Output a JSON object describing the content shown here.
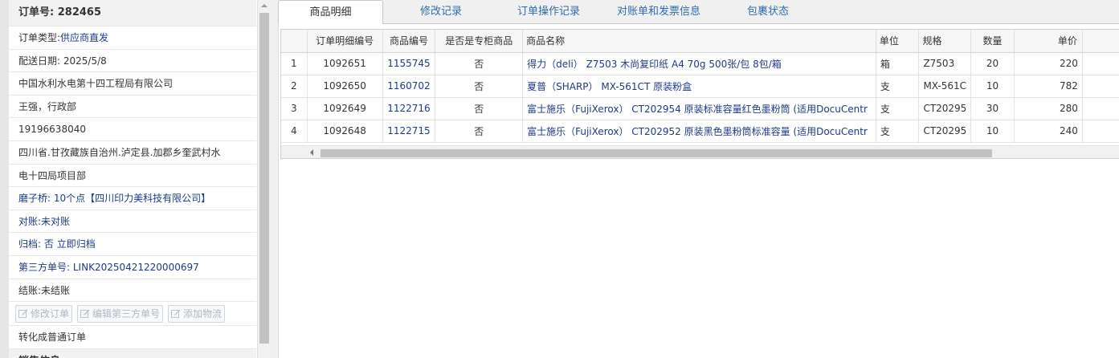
{
  "order": {
    "title": "订单号: 282465",
    "type": {
      "label": "订单类型:",
      "value": "供应商直发"
    },
    "delivery_date": "配送日期: 2025/5/8",
    "company": "中国水利水电第十四工程局有限公司",
    "contact": "王强，行政部",
    "phone": "19196638040",
    "address_line1": "四川省.甘孜藏族自治州.泸定县.加郡乡奎武村水",
    "address_line2": "电十四局项目部",
    "supplier": {
      "label": "磨子桥:",
      "value": "10个点【四川印力美科技有限公司】"
    },
    "reconcile": {
      "label": "对账:",
      "value": "未对账"
    },
    "archive": {
      "label": "归档:",
      "value": "否 立即归档"
    },
    "third_party": {
      "label": "第三方单号:",
      "value": "LINK20250421220000697"
    },
    "settlement": {
      "label": "结账:",
      "value": "未结账"
    },
    "buttons": {
      "edit_order": "修改订单",
      "edit_third": "编辑第三方单号",
      "add_logistics": "添加物流"
    },
    "convert": "转化成普通订单",
    "partial_next": "销售信息"
  },
  "tabs": [
    "商品明细",
    "修改记录",
    "订单操作记录",
    "对账单和发票信息",
    "包裹状态"
  ],
  "table": {
    "headers": [
      "订单明细编号",
      "商品编号",
      "是否是专柜商品",
      "商品名称",
      "单位",
      "规格",
      "数量",
      "单价"
    ],
    "rows": [
      {
        "n": "1",
        "detail": "1092651",
        "code": "1155745",
        "counter": "否",
        "name": "得力（deli） Z7503 木尚复印纸 A4 70g 500张/包 8包/箱",
        "unit": "箱",
        "spec": "Z7503",
        "qty": "20",
        "price": "220"
      },
      {
        "n": "2",
        "detail": "1092650",
        "code": "1160702",
        "counter": "否",
        "name": "夏普（SHARP） MX-561CT 原装粉盒",
        "unit": "支",
        "spec": "MX-561C",
        "qty": "10",
        "price": "782"
      },
      {
        "n": "3",
        "detail": "1092649",
        "code": "1122716",
        "counter": "否",
        "name": "富士施乐（FujiXerox） CT202954 原装标准容量红色墨粉筒 (适用DocuCentr",
        "unit": "支",
        "spec": "CT20295",
        "qty": "30",
        "price": "280"
      },
      {
        "n": "4",
        "detail": "1092648",
        "code": "1122715",
        "counter": "否",
        "name": "富士施乐（FujiXerox） CT202952 原装黑色墨粉筒标准容量 (适用DocuCentr",
        "unit": "支",
        "spec": "CT20295",
        "qty": "10",
        "price": "240"
      }
    ]
  }
}
